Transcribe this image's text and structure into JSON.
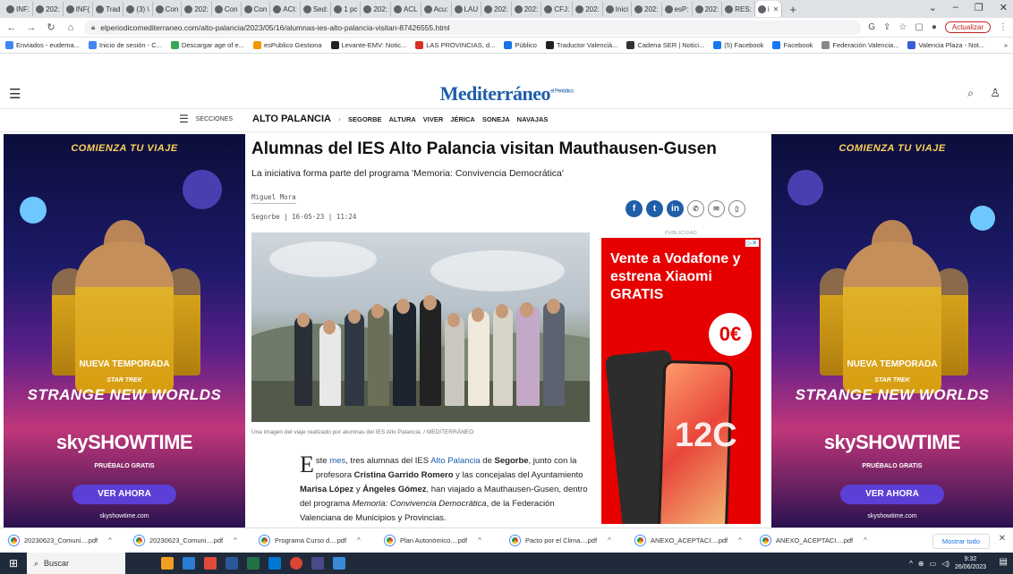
{
  "browser": {
    "tabs": [
      {
        "label": "INF:"
      },
      {
        "label": "202:"
      },
      {
        "label": "INF("
      },
      {
        "label": "Trad"
      },
      {
        "label": "(3) \\"
      },
      {
        "label": "Con"
      },
      {
        "label": "202:"
      },
      {
        "label": "Con"
      },
      {
        "label": "Con"
      },
      {
        "label": "ACI:"
      },
      {
        "label": "Sed:"
      },
      {
        "label": "1 pc"
      },
      {
        "label": "202:"
      },
      {
        "label": "ACL"
      },
      {
        "label": "Acu:"
      },
      {
        "label": "LAU"
      },
      {
        "label": "202:"
      },
      {
        "label": "202:"
      },
      {
        "label": "CFJ:"
      },
      {
        "label": "202:"
      },
      {
        "label": "Inici"
      },
      {
        "label": "202:"
      },
      {
        "label": "esP:"
      },
      {
        "label": "202:"
      },
      {
        "label": "RES:"
      },
      {
        "label": "i"
      }
    ],
    "url": "elperiodicomediterraneo.com/alto-palancia/2023/05/16/alumnas-ies-alto-palancia-visitan-87426555.html",
    "update_label": "Actualizar",
    "bookmarks": [
      "Enviados - eudema...",
      "Inicio de sesión - C...",
      "Descargar age of e...",
      "esPublico Gestiona",
      "Levante-EMV: Notic...",
      "LAS PROVINCIAS, d...",
      "Público",
      "Traductor Valencià...",
      "Cadena SER | Notici...",
      "(5) Facebook",
      "Facebook",
      "Federación Valencia...",
      "Valencia Plaza - Not..."
    ],
    "bookmarks_more": "»"
  },
  "site": {
    "logo": "Mediterráneo",
    "logo_sup": "el Periódico",
    "sections_label": "SECCIONES",
    "section_main": "ALTO PALANCIA",
    "section_items": [
      "SEGORBE",
      "ALTURA",
      "VIVER",
      "JÉRICA",
      "SONEJA",
      "NAVAJAS"
    ]
  },
  "article": {
    "headline": "Alumnas del IES Alto Palancia visitan Mauthausen-Gusen",
    "standfirst": "La iniciativa forma parte del programa 'Memoria: Convivencia Democrática'",
    "author": "Miguel Mora",
    "dateline": "Segorbe | 16·05·23 | 11:24",
    "caption": "Una imagen del viaje realizado por alumnas del IES Alto Palancia.  / MEDITERRÁNEO",
    "body": {
      "dropcap": "E",
      "p1": "ste ",
      "link1": "mes",
      "p2": ", tres alumnas del IES ",
      "link2": "Alto Palancia",
      "p3": " de ",
      "b1": "Segorbe",
      "p4": ", junto con la profesora ",
      "b2": "Cristina Garrido Romero",
      "p5": " y las concejalas del Ayuntamiento ",
      "b3": "Marisa López",
      "p6": " y ",
      "b4": "Ángeles Gómez",
      "p7": ", han viajado a Mauthausen-Gusen, dentro del programa ",
      "i1": "Memoria: Convivencia Democrática",
      "p8": ", de la Federación Valenciana de Municipios y Provincias."
    }
  },
  "ads": {
    "publicidad": "PUBLICIDAD",
    "vodafone": {
      "line": "Vente a Vodafone y estrena Xiaomi GRATIS",
      "price": "0€",
      "model": "12C"
    },
    "skyshowtime": {
      "top": "COMIENZA TU VIAJE",
      "season": "NUEVA TEMPORADA",
      "series_small": "STAR TREK",
      "series": "STRANGE NEW WORLDS",
      "brand": "skySHOWTIME",
      "try": "PRUÉBALO GRATIS",
      "cta": "VER AHORA",
      "url": "skyshowtime.com"
    }
  },
  "downloads": {
    "items": [
      "20230623_Comuni....pdf",
      "20230623_Comuni....pdf",
      "Programa Curso d....pdf",
      "Plan Autonómico....pdf",
      "Pacto por el Clima....pdf",
      "ANEXO_ACEPTACI....pdf",
      "ANEXO_ACEPTACI....pdf"
    ],
    "show_all": "Mostrar todo"
  },
  "taskbar": {
    "search": "Buscar",
    "time": "9:32",
    "date": "26/06/2023"
  }
}
